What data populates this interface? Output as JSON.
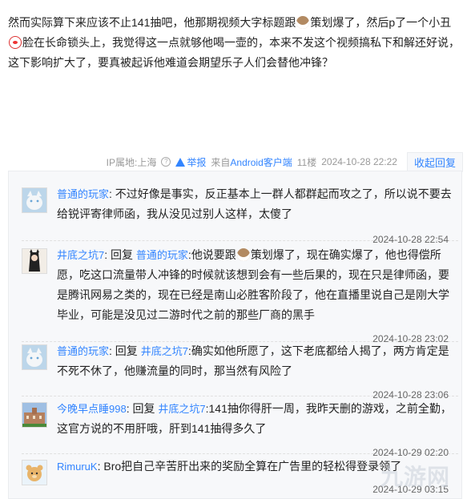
{
  "post": {
    "p1": "然而实际算下来应该不止141抽吧，他那期视频大字标题跟",
    "p2": "策划爆了，然后p了一个小丑",
    "p3": "脸在长命锁头上，我觉得这一点就够他喝一壶的，本来不发这个视频搞私下和解还好说，这下影响扩大了，要真被起诉他难道会期望乐子人们会替他冲锋？"
  },
  "meta": {
    "ip": "IP属地:上海",
    "report": "举报",
    "from": "来自",
    "client": "Android客户端",
    "floor": "11楼",
    "time": "2024-10-28 22:22",
    "collapse": "收起回复"
  },
  "replies": [
    {
      "user": "普通的玩家",
      "mid": "",
      "target": "",
      "text": "不过好像是事实，反正基本上一群人都群起而攻之了，所以说不要去给锐评寄律师函，我从没见过别人这样，太傻了",
      "time": "2024-10-28 22:54"
    },
    {
      "user": "井底之坑7",
      "mid": "回复",
      "target": "普通的玩家",
      "text": "他说要跟",
      "text2": "策划爆了，现在确实爆了，他也得偿所愿，吃这口流量带人冲锋的时候就该想到会有一些后果的，现在只是律师函，要是腾讯网易之类的，现在已经是南山必胜客阶段了，他在直播里说自己是刚大学毕业，可能是没见过二游时代之前的那些厂商的黑手",
      "time": "2024-10-28 23:02"
    },
    {
      "user": "普通的玩家",
      "mid": "回复",
      "target": "井底之坑7",
      "text": "确实如他所愿了，这下老底都给人揭了，两方肯定是不死不休了，他赚流量的同时，那当然有风险了",
      "time": "2024-10-28 23:06"
    },
    {
      "user": "今晚早点睡998",
      "mid": "回复",
      "target": "井底之坑7",
      "text": "141抽你得肝一周，我昨天删的游戏，之前全勤，这官方说的不用肝哦，肝到141抽得多久了",
      "time": "2024-10-29 02:20"
    },
    {
      "user": "RimuruK",
      "mid": "",
      "target": "",
      "text": "Bro把自己辛苦肝出来的奖励全算在广告里的轻松得登录领了",
      "time": "2024-10-29 03:15"
    }
  ],
  "watermark": "九游网"
}
